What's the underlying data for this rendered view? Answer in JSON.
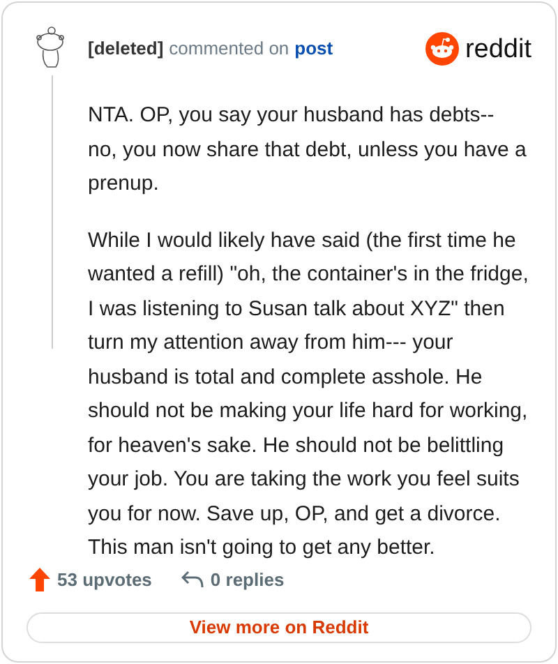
{
  "header": {
    "author": "[deleted]",
    "action": "commented on",
    "target": "post",
    "brand": "reddit"
  },
  "paragraphs": [
    "NTA. OP, you say your husband has debts-- no, you now share that debt, unless you have a prenup.",
    "While I would likely have said (the first time he wanted a refill) \"oh, the container's in the fridge, I was listening to Susan talk about XYZ\" then turn my attention away from him--- your husband is total and complete asshole. He should not be making your life hard for working, for heaven's sake. He should not be belittling your job. You are taking the work you feel suits you for now. Save up, OP, and get a divorce. This man isn't going to get any better."
  ],
  "footer": {
    "upvotes": "53 upvotes",
    "replies": "0 replies",
    "button": "View more on Reddit"
  }
}
